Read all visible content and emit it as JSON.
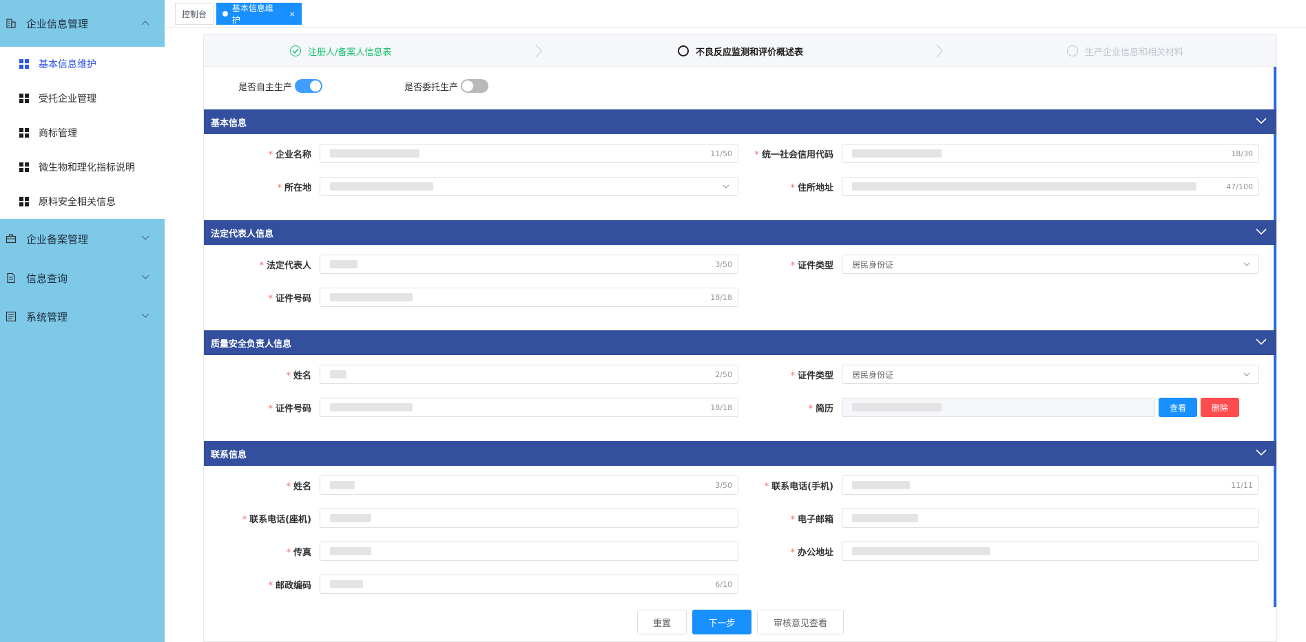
{
  "sidebar": {
    "groups": [
      {
        "label": "企业信息管理",
        "icon": "building-icon"
      },
      {
        "label": "企业备案管理",
        "icon": "briefcase-icon"
      },
      {
        "label": "信息查询",
        "icon": "document-icon"
      },
      {
        "label": "系统管理",
        "icon": "settings-panel-icon"
      }
    ],
    "items": [
      {
        "label": "基本信息维护"
      },
      {
        "label": "受托企业管理"
      },
      {
        "label": "商标管理"
      },
      {
        "label": "微生物和理化指标说明"
      },
      {
        "label": "原料安全相关信息"
      }
    ]
  },
  "tabs": [
    {
      "label": "控制台"
    },
    {
      "label": "基本信息维护",
      "close": "×"
    }
  ],
  "steps": [
    {
      "label": "注册人/备案人信息表",
      "state": "done"
    },
    {
      "label": "不良反应监测和评价概述表",
      "state": "current"
    },
    {
      "label": "生产企业信息和相关材料",
      "state": "pending"
    }
  ],
  "toggles": [
    {
      "label": "是否自主生产",
      "on": true
    },
    {
      "label": "是否委托生产",
      "on": false
    }
  ],
  "sections": {
    "basic": {
      "title": "基本信息",
      "company_name": {
        "label": "企业名称",
        "count": "11/50"
      },
      "credit_code": {
        "label": "统一社会信用代码",
        "count": "18/30"
      },
      "location": {
        "label": "所在地"
      },
      "address": {
        "label": "住所地址",
        "count": "47/100"
      }
    },
    "legal": {
      "title": "法定代表人信息",
      "rep": {
        "label": "法定代表人",
        "count": "3/50"
      },
      "id_type": {
        "label": "证件类型",
        "value": "居民身份证"
      },
      "id_no": {
        "label": "证件号码",
        "count": "18/18"
      }
    },
    "quality": {
      "title": "质量安全负责人信息",
      "name": {
        "label": "姓名",
        "count": "2/50"
      },
      "id_type": {
        "label": "证件类型",
        "value": "居民身份证"
      },
      "id_no": {
        "label": "证件号码",
        "count": "18/18"
      },
      "resume": {
        "label": "简历"
      },
      "view_btn": "查看",
      "delete_btn": "删除"
    },
    "contact": {
      "title": "联系信息",
      "name": {
        "label": "姓名",
        "count": "3/50"
      },
      "mobile": {
        "label": "联系电话(手机)",
        "count": "11/11"
      },
      "landline": {
        "label": "联系电话(座机)"
      },
      "email": {
        "label": "电子邮箱"
      },
      "fax": {
        "label": "传真"
      },
      "office": {
        "label": "办公地址"
      },
      "postcode": {
        "label": "邮政编码",
        "count": "6/10"
      }
    }
  },
  "actions": {
    "reset": "重置",
    "next": "下一步",
    "review": "审核意见查看"
  },
  "colors": {
    "sidebar_bg": "#7ec9e8",
    "section_header": "#334f9e",
    "primary": "#1890ff",
    "danger": "#ff4d4f",
    "step_done": "#13c26b",
    "required": "#f56c6c"
  }
}
